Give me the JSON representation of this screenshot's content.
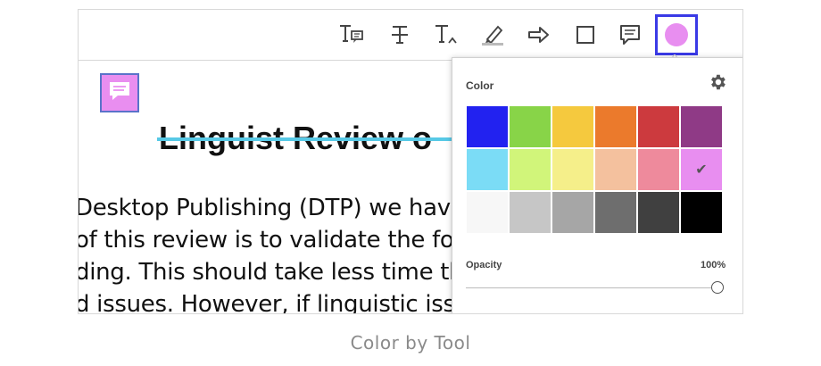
{
  "toolbar": {
    "tools": [
      {
        "name": "text-comment-tool",
        "icon": "text-comment-icon"
      },
      {
        "name": "strikethrough-tool",
        "icon": "strikethrough-icon"
      },
      {
        "name": "insert-text-tool",
        "icon": "insert-text-icon"
      },
      {
        "name": "highlighter-tool",
        "icon": "highlighter-icon"
      },
      {
        "name": "arrow-tool",
        "icon": "arrow-icon"
      },
      {
        "name": "rectangle-tool",
        "icon": "rectangle-icon"
      },
      {
        "name": "sticky-note-tool",
        "icon": "sticky-note-icon"
      },
      {
        "name": "color-tool",
        "icon": "color-circle-icon",
        "active": true
      }
    ],
    "active_color": "#e88ef0",
    "active_border_color": "#3a3ae6"
  },
  "document": {
    "title": "Linguist Review o",
    "lines": [
      "Desktop Publishing (DTP) we have li",
      "of this review is to validate the forr",
      "ding. This should take less time thar",
      "d issues. However, if linguistic issue"
    ],
    "strike_color": "#57c9e6",
    "note_color": "#e98ef0"
  },
  "color_popup": {
    "color_label": "Color",
    "opacity_label": "Opacity",
    "opacity_value": "100%",
    "opacity_level": 1.0,
    "settings_icon": "gear-icon",
    "selected_index": 11,
    "swatches": [
      "#2222f0",
      "#88d448",
      "#f5c93e",
      "#eb7a2c",
      "#cc3a3e",
      "#8f3a86",
      "#7bdcf6",
      "#d1f57a",
      "#f5ef8a",
      "#f4c19e",
      "#ee8a9c",
      "#e88ef0",
      "#f7f7f7",
      "#c6c6c6",
      "#a6a6a6",
      "#6e6e6e",
      "#404040",
      "#000000"
    ]
  },
  "caption": "Color by Tool"
}
